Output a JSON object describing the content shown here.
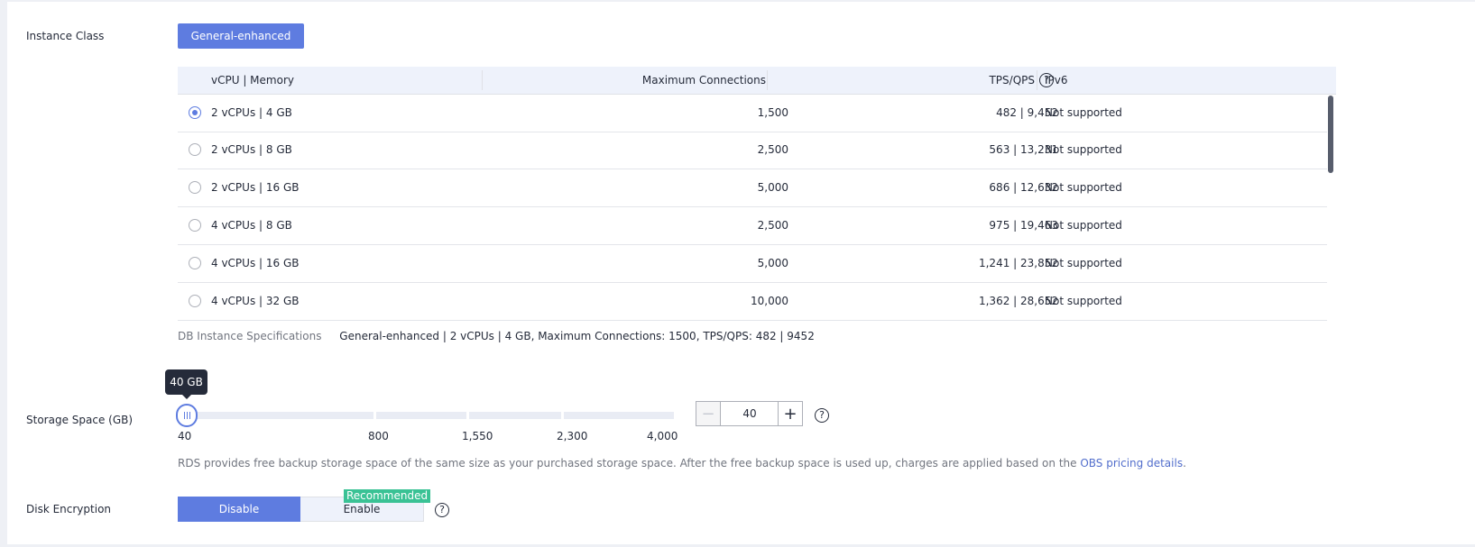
{
  "instance_class": {
    "label": "Instance Class",
    "selected": "General-enhanced"
  },
  "spec_table": {
    "columns": {
      "vcpu_memory": "vCPU | Memory",
      "max_connections": "Maximum Connections",
      "tps_qps": "TPS/QPS",
      "ipv6": "IPv6"
    },
    "selected_index": 0,
    "rows": [
      {
        "vcpu_memory": "2 vCPUs | 4 GB",
        "max_connections": "1,500",
        "tps_qps": "482 | 9,452",
        "ipv6": "Not supported"
      },
      {
        "vcpu_memory": "2 vCPUs | 8 GB",
        "max_connections": "2,500",
        "tps_qps": "563 | 13,231",
        "ipv6": "Not supported"
      },
      {
        "vcpu_memory": "2 vCPUs | 16 GB",
        "max_connections": "5,000",
        "tps_qps": "686 | 12,632",
        "ipv6": "Not supported"
      },
      {
        "vcpu_memory": "4 vCPUs | 8 GB",
        "max_connections": "2,500",
        "tps_qps": "975 | 19,463",
        "ipv6": "Not supported"
      },
      {
        "vcpu_memory": "4 vCPUs | 16 GB",
        "max_connections": "5,000",
        "tps_qps": "1,241 | 23,852",
        "ipv6": "Not supported"
      },
      {
        "vcpu_memory": "4 vCPUs | 32 GB",
        "max_connections": "10,000",
        "tps_qps": "1,362 | 28,652",
        "ipv6": "Not supported"
      }
    ]
  },
  "db_spec": {
    "label": "DB Instance Specifications",
    "value": "General-enhanced | 2 vCPUs | 4 GB, Maximum Connections: 1500, TPS/QPS: 482 | 9452"
  },
  "storage": {
    "label": "Storage Space (GB)",
    "tooltip": "40 GB",
    "value": "40",
    "ticks": [
      "40",
      "800",
      "1,550",
      "2,300",
      "4,000"
    ],
    "minus": "−",
    "plus": "+",
    "note": "RDS provides free backup storage space of the same size as your purchased storage space. After the free backup space is used up, charges are applied based on the ",
    "note_link": "OBS pricing details",
    "note_end": "."
  },
  "disk_encryption": {
    "label": "Disk Encryption",
    "options": [
      "Disable",
      "Enable"
    ],
    "selected": "Disable",
    "badge": "Recommended"
  },
  "help_glyph": "?",
  "colors": {
    "accent": "#5e7ce0",
    "badge": "#3ac295",
    "link": "#526ecc",
    "header_bg": "#eef2fb"
  }
}
